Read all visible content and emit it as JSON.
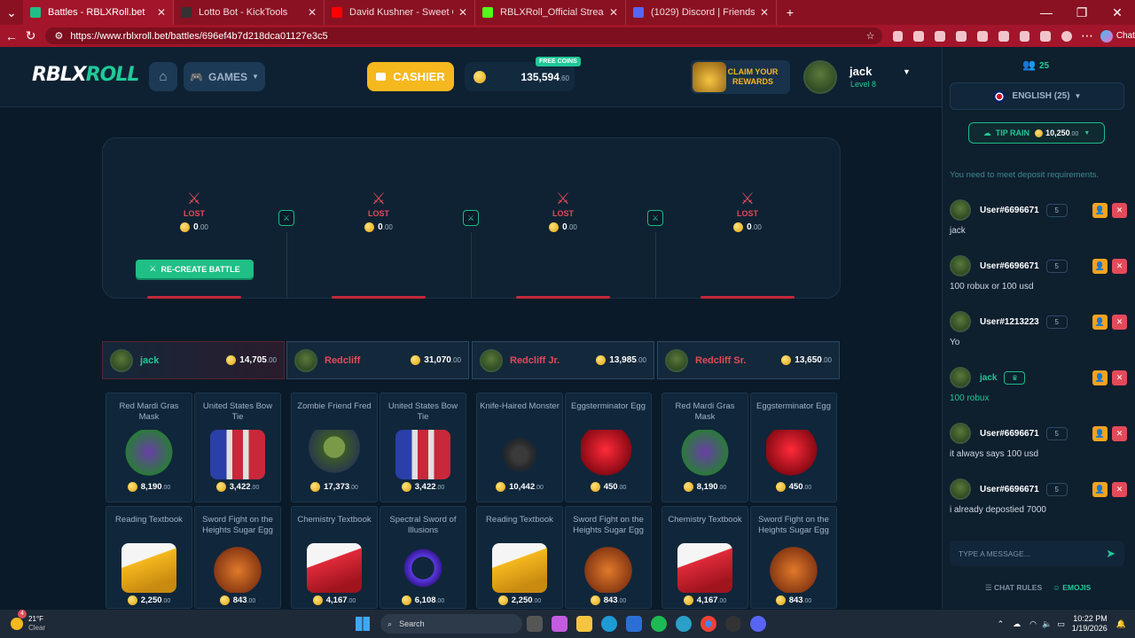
{
  "browser": {
    "tabs": [
      {
        "title": "Battles - RBLXRoll.bet",
        "active": true,
        "color": "#1fbf86"
      },
      {
        "title": "Lotto Bot - KickTools",
        "active": false,
        "color": "#333333"
      },
      {
        "title": "David Kushner - Sweet Oblivion (L",
        "active": false,
        "color": "#ff0000"
      },
      {
        "title": "RBLXRoll_Official Stream - Watch L",
        "active": false,
        "color": "#53fc18"
      },
      {
        "title": "(1029) Discord | Friends",
        "active": false,
        "color": "#5865f2"
      }
    ],
    "url": "https://www.rblxroll.bet/battles/696ef4b7d218dca01127e3c5",
    "chat_label": "Chat"
  },
  "header": {
    "logo_left": "RBLX",
    "logo_right": "ROLL",
    "games_label": "GAMES",
    "cashier_label": "CASHIER",
    "free_coins_label": "FREE COINS",
    "balance_main": "135,594",
    "balance_dec": ".60",
    "rewards_label": "CLAIM YOUR REWARDS",
    "username": "jack",
    "level": "Level 8"
  },
  "battle": {
    "slots": [
      {
        "status": "LOST",
        "value": "0",
        "dec": ".00"
      },
      {
        "status": "LOST",
        "value": "0",
        "dec": ".00"
      },
      {
        "status": "LOST",
        "value": "0",
        "dec": ".00"
      },
      {
        "status": "LOST",
        "value": "0",
        "dec": ".00"
      }
    ],
    "recreate_label": "RE-CREATE BATTLE"
  },
  "players": [
    {
      "name": "jack",
      "amount": "14,705",
      "dec": ".00",
      "winner": false
    },
    {
      "name": "Redcliff",
      "amount": "31,070",
      "dec": ".00",
      "winner": true
    },
    {
      "name": "Redcliff Jr.",
      "amount": "13,985",
      "dec": ".00",
      "winner": true
    },
    {
      "name": "Redcliff Sr.",
      "amount": "13,650",
      "dec": ".00",
      "winner": true
    }
  ],
  "items_row1": [
    {
      "name": "Red Mardi Gras Mask",
      "price": "8,190",
      "dec": ".00"
    },
    {
      "name": "United States Bow Tie",
      "price": "3,422",
      "dec": ".00"
    },
    {
      "name": "Zombie Friend Fred",
      "price": "17,373",
      "dec": ".00"
    },
    {
      "name": "United States Bow Tie",
      "price": "3,422",
      "dec": ".00"
    },
    {
      "name": "Knife-Haired Monster",
      "price": "10,442",
      "dec": ".00"
    },
    {
      "name": "Eggsterminator Egg",
      "price": "450",
      "dec": ".00"
    },
    {
      "name": "Red Mardi Gras Mask",
      "price": "8,190",
      "dec": ".00"
    },
    {
      "name": "Eggsterminator Egg",
      "price": "450",
      "dec": ".00"
    }
  ],
  "items_row2": [
    {
      "name": "Reading Textbook",
      "price": "2,250",
      "dec": ".00"
    },
    {
      "name": "Sword Fight on the Heights Sugar Egg",
      "price": "843",
      "dec": ".00"
    },
    {
      "name": "Chemistry Textbook",
      "price": "4,167",
      "dec": ".00"
    },
    {
      "name": "Spectral Sword of Illusions",
      "price": "6,108",
      "dec": ".00"
    },
    {
      "name": "Reading Textbook",
      "price": "2,250",
      "dec": ".00"
    },
    {
      "name": "Sword Fight on the Heights Sugar Egg",
      "price": "843",
      "dec": ".00"
    },
    {
      "name": "Chemistry Textbook",
      "price": "4,167",
      "dec": ".00"
    },
    {
      "name": "Sword Fight on the Heights Sugar Egg",
      "price": "843",
      "dec": ".00"
    }
  ],
  "chat": {
    "online": "25",
    "language": "ENGLISH (25)",
    "tip_rain_label": "TIP RAIN",
    "tip_rain_amount": "10,250",
    "tip_rain_dec": ".00",
    "warning": "You need to meet deposit requirements.",
    "messages": [
      {
        "user": "User#6696671",
        "level": "5",
        "text": "jack"
      },
      {
        "user": "User#6696671",
        "level": "5",
        "text": "100 robux or 100 usd"
      },
      {
        "user": "User#1213223",
        "level": "5",
        "text": "Yo"
      },
      {
        "user": "jack",
        "level": "",
        "text": "100 robux"
      },
      {
        "user": "User#6696671",
        "level": "5",
        "text": "it always says 100 usd"
      },
      {
        "user": "User#6696671",
        "level": "5",
        "text": "i already depostied 7000"
      }
    ],
    "input_placeholder": "TYPE A MESSAGE...",
    "rules_label": "CHAT RULES",
    "emojis_label": "EMOJIS"
  },
  "taskbar": {
    "weather_temp": "21°F",
    "weather_desc": "Clear",
    "search_label": "Search",
    "time": "10:22 PM",
    "date": "1/19/2026",
    "weather_badge": "4"
  }
}
